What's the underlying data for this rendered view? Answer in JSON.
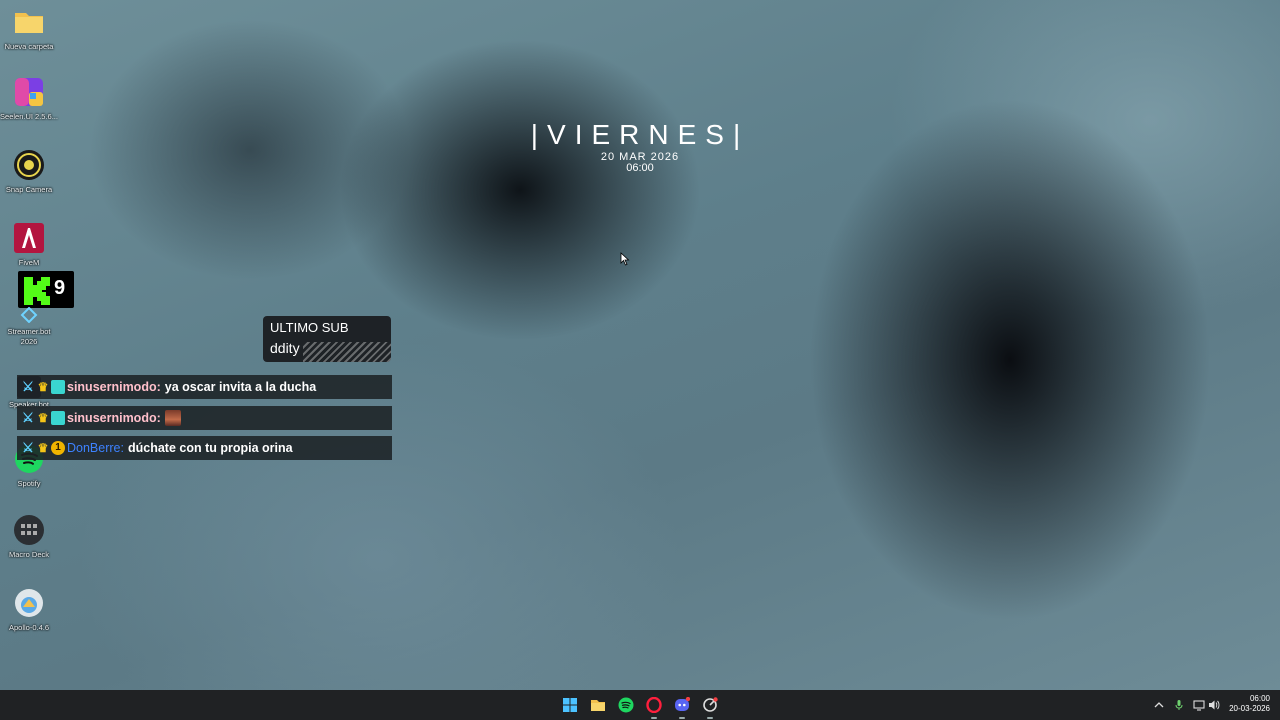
{
  "desktop_icons": [
    {
      "label": "Nueva carpeta",
      "icon": "folder-icon"
    },
    {
      "label": "Seelen.UI 2.5.6...",
      "icon": "seelen-ui-icon"
    },
    {
      "label": "Snap Camera",
      "icon": "snap-camera-icon"
    },
    {
      "label": "FiveM",
      "icon": "fivem-icon"
    },
    {
      "label": "Streamer.bot 2026",
      "icon": "streamerbot-icon"
    },
    {
      "label": "Speaker.bot",
      "icon": "speakerbot-icon"
    },
    {
      "label": "Spotify",
      "icon": "spotify-icon"
    },
    {
      "label": "Macro Deck",
      "icon": "macro-deck-icon"
    },
    {
      "label": "Apollo-0.4.6",
      "icon": "apollo-icon"
    }
  ],
  "kick_badge": {
    "number": "9"
  },
  "clock_widget": {
    "day": "|VIERNES|",
    "date": "20 MAR 2026",
    "time": "06:00"
  },
  "last_sub": {
    "title": "ULTIMO SUB",
    "name": "ddity"
  },
  "chat_messages": [
    {
      "user": "sinusernimodo:",
      "text": "ya oscar invita a la ducha"
    },
    {
      "user": "sinusernimodo:",
      "text": ""
    },
    {
      "user": "DonBerre:",
      "text": "dúchate con tu propia orina",
      "badge_number": "1"
    }
  ],
  "taskbar": {
    "apps": [
      "windows-start-icon",
      "file-explorer-icon",
      "spotify-icon",
      "opera-gx-icon",
      "discord-icon",
      "steelseries-icon"
    ],
    "clock_time": "06:00",
    "clock_date": "20-03-2026"
  },
  "colors": {
    "taskbar": "#202224",
    "chat_bg": "#1c2226",
    "pink_user": "#ffc0cb",
    "blue_user": "#3d82ff"
  }
}
